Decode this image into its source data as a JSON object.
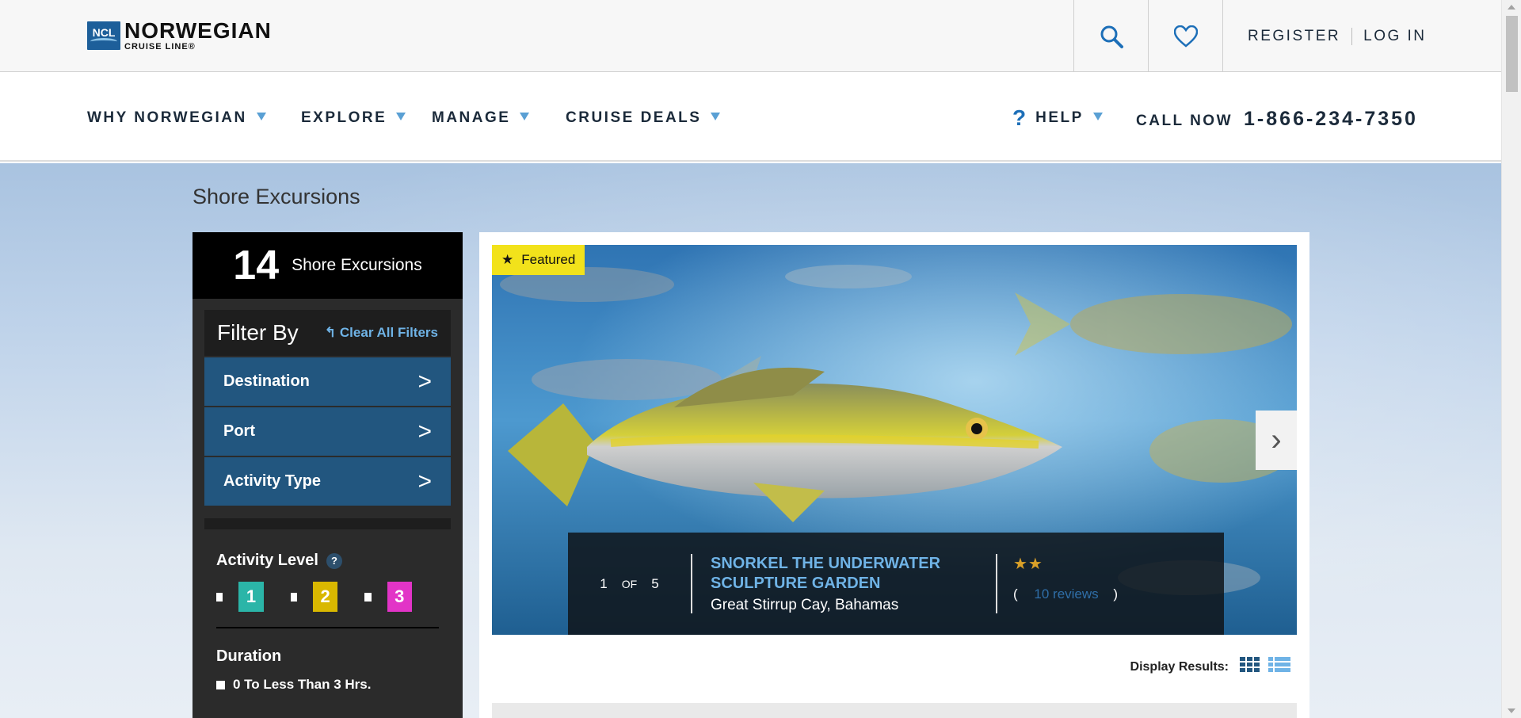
{
  "brand": {
    "logo_box": "NCL",
    "logo_main": "NORWEGIAN",
    "logo_sub": "CRUISE LINE®"
  },
  "topbar": {
    "register": "REGISTER",
    "login": "LOG IN",
    "icons": [
      "search-icon",
      "heart-icon"
    ]
  },
  "nav": {
    "items": [
      {
        "label": "WHY NORWEGIAN"
      },
      {
        "label": "EXPLORE"
      },
      {
        "label": "MANAGE"
      },
      {
        "label": "CRUISE DEALS"
      }
    ],
    "help": "HELP",
    "call_label": "CALL NOW",
    "phone": "1-866-234-7350"
  },
  "page": {
    "title": "Shore Excursions"
  },
  "sidebar": {
    "count": "14",
    "count_label": "Shore Excursions",
    "filter_title": "Filter By",
    "clear_filters": "Clear All Filters",
    "filters": [
      {
        "label": "Destination"
      },
      {
        "label": "Port"
      },
      {
        "label": "Activity Type"
      }
    ],
    "activity_level_title": "Activity Level",
    "activity_levels": [
      "1",
      "2",
      "3"
    ],
    "duration_title": "Duration",
    "duration_options": [
      "0 To Less Than 3 Hrs."
    ]
  },
  "featured": {
    "badge": "Featured",
    "current": "1",
    "of": "OF",
    "total": "5",
    "title": "SNORKEL THE UNDERWATER SCULPTURE GARDEN",
    "location": "Great Stirrup Cay, Bahamas",
    "rating_stars": 2,
    "reviews_open": "(",
    "reviews": "10 reviews",
    "reviews_close": ")"
  },
  "display_results": {
    "label": "Display Results:"
  },
  "colors": {
    "nav_blue": "#22567f",
    "accent_blue": "#6fb3e6",
    "badge_yellow": "#f2e21b",
    "level1": "#2bb5a8",
    "level2": "#d9b800",
    "level3": "#e234c7"
  }
}
